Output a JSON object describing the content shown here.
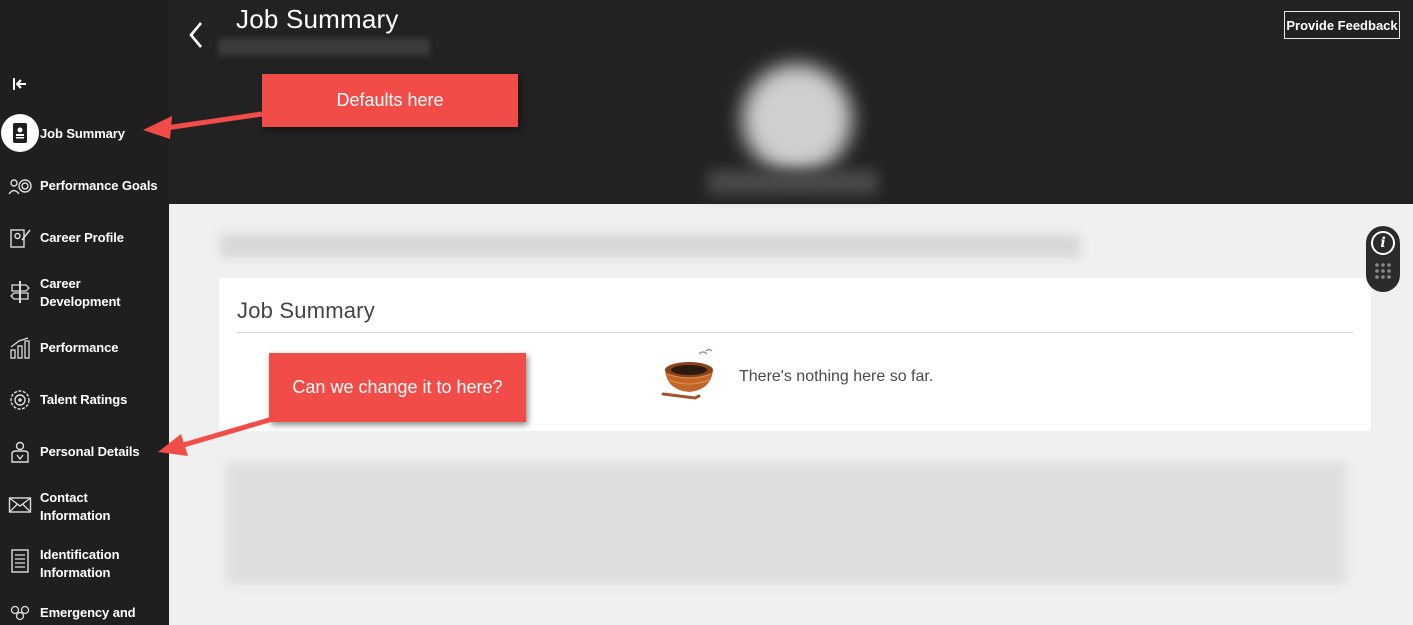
{
  "header": {
    "title": "Job Summary",
    "feedback_label": "Provide Feedback"
  },
  "sidebar": {
    "items": [
      {
        "label": "Job Summary",
        "icon": "id-badge-icon",
        "active": true
      },
      {
        "label": "Performance Goals",
        "icon": "target-goals-icon"
      },
      {
        "label": "Career Profile",
        "icon": "career-profile-icon"
      },
      {
        "label": "Career\nDevelopment",
        "icon": "signpost-icon"
      },
      {
        "label": "Performance",
        "icon": "bar-chart-icon"
      },
      {
        "label": "Talent Ratings",
        "icon": "award-medal-icon"
      },
      {
        "label": "Personal Details",
        "icon": "person-badge-icon"
      },
      {
        "label": "Contact\nInformation",
        "icon": "envelope-icon"
      },
      {
        "label": "Identification\nInformation",
        "icon": "document-lines-icon"
      },
      {
        "label": "Emergency and",
        "icon": "people-group-icon"
      }
    ]
  },
  "main": {
    "card_title": "Job Summary",
    "empty_message": "There's nothing here so far."
  },
  "annotations": {
    "callout_1": "Defaults here",
    "callout_2": "Can we change it to here?",
    "callout_color": "#f24c48"
  },
  "colors": {
    "sidebar_bg": "#1f1f1f",
    "header_bg": "#222222",
    "content_bg": "#f0f0f0"
  }
}
